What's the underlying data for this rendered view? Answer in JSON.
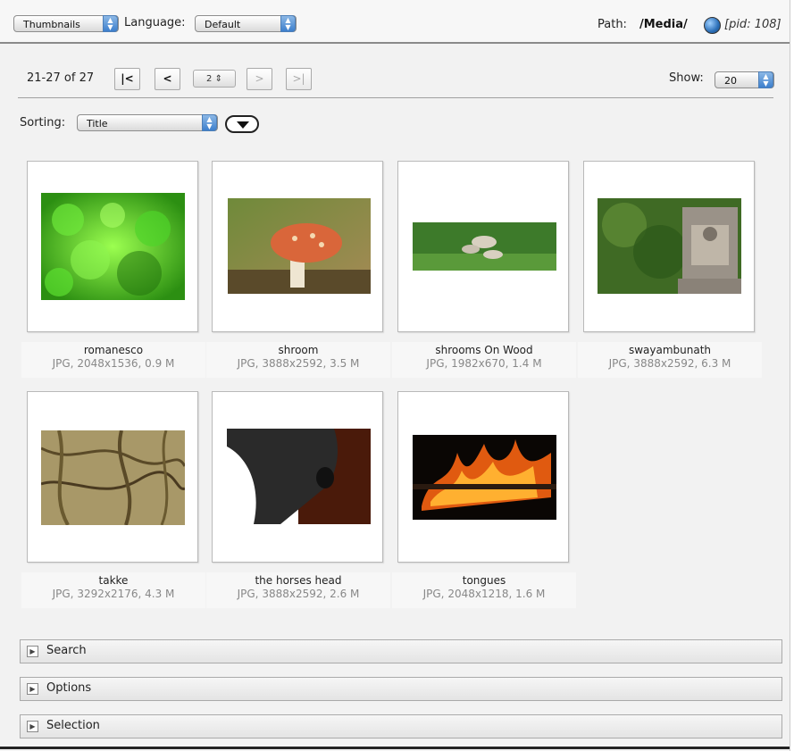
{
  "toolbar": {
    "view_mode": "Thumbnails",
    "language_label": "Language:",
    "language_value": "Default",
    "path_label": "Path:",
    "path_value": "/Media/",
    "pid_text": "[pid: 108]"
  },
  "pager": {
    "range_text": "21-27 of 27",
    "first": "|<",
    "prev": "<",
    "page": "2",
    "next": ">",
    "last": ">|",
    "show_label": "Show:",
    "show_value": "20"
  },
  "sorting": {
    "label": "Sorting:",
    "value": "Title"
  },
  "items": [
    {
      "name": "romanesco",
      "meta": "JPG, 2048x1536, 0.9 M"
    },
    {
      "name": "shroom",
      "meta": "JPG, 3888x2592, 3.5 M"
    },
    {
      "name": "shrooms On Wood",
      "meta": "JPG, 1982x670, 1.4 M"
    },
    {
      "name": "swayambunath",
      "meta": "JPG, 3888x2592, 6.3 M"
    },
    {
      "name": "takke",
      "meta": "JPG, 3292x2176, 4.3 M"
    },
    {
      "name": "the horses head",
      "meta": "JPG, 3888x2592, 2.6 M"
    },
    {
      "name": "tongues",
      "meta": "JPG, 2048x1218, 1.6 M"
    }
  ],
  "panels": {
    "search": "Search",
    "options": "Options",
    "selection": "Selection"
  }
}
